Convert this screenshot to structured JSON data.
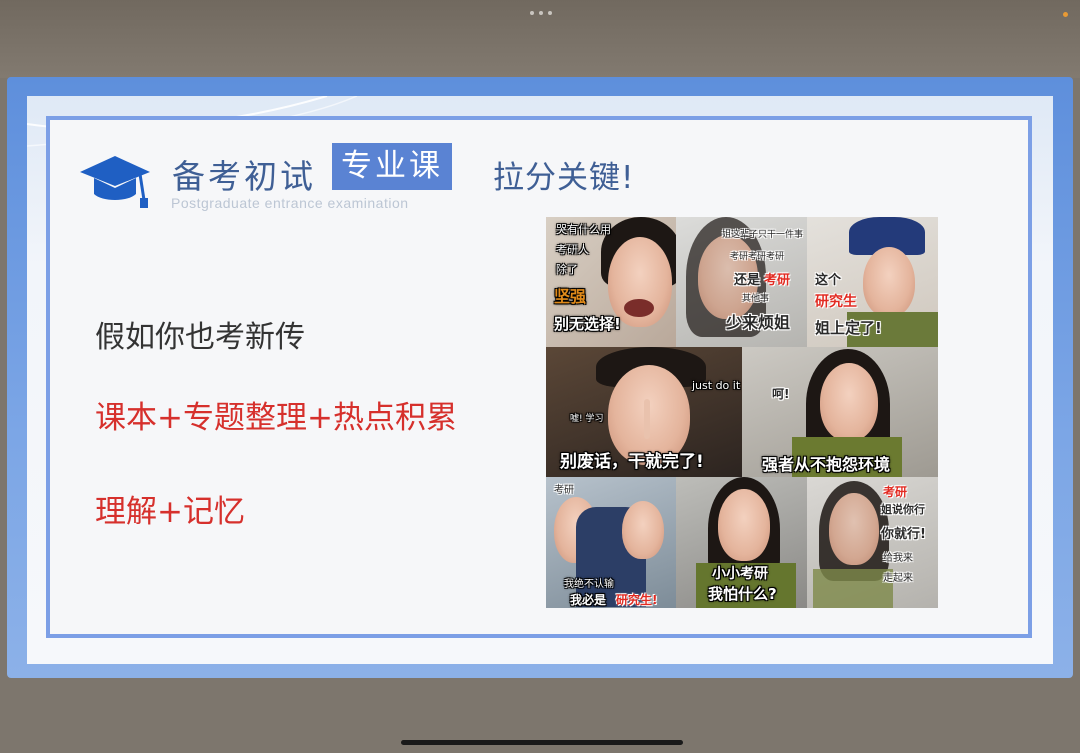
{
  "slide": {
    "title_main": "备考初试",
    "title_tag": "专业课",
    "title_sub": "拉分关键!",
    "subtitle_en": "Postgraduate entrance examination",
    "line1": "假如你也考新传",
    "line2": "课本+专题整理+热点积累",
    "line3": "理解+记忆"
  },
  "memes": {
    "m1": [
      "哭有什么用",
      "考研人",
      "除了",
      "坚强",
      "别无选择!"
    ],
    "m2": [
      "姐这辈子只干一件事",
      "考研考研考研",
      "还是",
      "考研",
      "其他事",
      "少来烦姐"
    ],
    "m3": [
      "这个",
      "研究生",
      "姐上定了!"
    ],
    "m4": [
      "just do it !",
      "嘘! 学习",
      "别废话，干就完了!"
    ],
    "m5": [
      "呵!",
      "强者从不抱怨环境"
    ],
    "m6": [
      "考研",
      "我绝不认输",
      "我必是",
      "研究生!"
    ],
    "m7": [
      "小小考研",
      "我怕什么?"
    ],
    "m8": [
      "考研",
      "姐说你行",
      "你就行!",
      "给我来",
      "走起来"
    ]
  },
  "colors": {
    "frame_blue": "#5e8fdc",
    "box_border": "#7c9fe6",
    "title_blue": "#3f5f95",
    "tag_bg": "#5a83d3",
    "accent_red": "#d6302c"
  },
  "icons": {
    "cap": "graduation-cap-icon"
  }
}
